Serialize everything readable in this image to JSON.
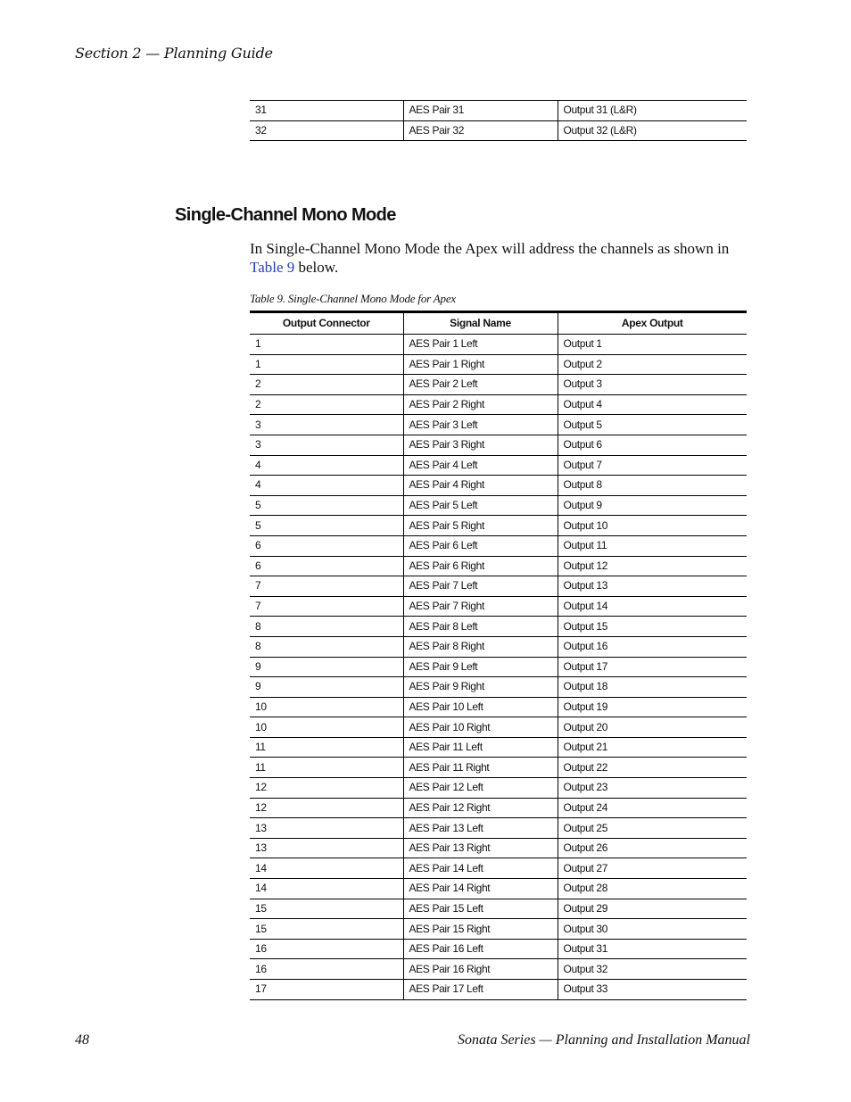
{
  "header": {
    "running_head": "Section 2 — Planning Guide"
  },
  "previous_table_rows": [
    {
      "connector": "31",
      "signal": "AES Pair 31",
      "output": "Output 31 (L&R)"
    },
    {
      "connector": "32",
      "signal": "AES Pair 32",
      "output": "Output 32 (L&R)"
    }
  ],
  "section": {
    "heading": "Single-Channel Mono Mode",
    "paragraph_before_link": "In Single-Channel Mono Mode the Apex will address the channels as shown in ",
    "link_text": "Table 9",
    "paragraph_after_link": " below.",
    "link_color": "#1f3fd6"
  },
  "table": {
    "caption": "Table 9.  Single-Channel Mono Mode for Apex",
    "columns": [
      "Output Connector",
      "Signal Name",
      "Apex Output"
    ],
    "rows": [
      {
        "connector": "1",
        "signal": "AES Pair 1 Left",
        "output": "Output 1"
      },
      {
        "connector": "1",
        "signal": "AES Pair 1 Right",
        "output": "Output 2"
      },
      {
        "connector": "2",
        "signal": "AES Pair 2 Left",
        "output": "Output 3"
      },
      {
        "connector": "2",
        "signal": "AES Pair 2 Right",
        "output": "Output 4"
      },
      {
        "connector": "3",
        "signal": "AES Pair 3 Left",
        "output": "Output 5"
      },
      {
        "connector": "3",
        "signal": "AES Pair 3 Right",
        "output": "Output 6"
      },
      {
        "connector": "4",
        "signal": "AES Pair 4 Left",
        "output": "Output 7"
      },
      {
        "connector": "4",
        "signal": "AES Pair 4 Right",
        "output": "Output 8"
      },
      {
        "connector": "5",
        "signal": "AES Pair 5 Left",
        "output": "Output 9"
      },
      {
        "connector": "5",
        "signal": "AES Pair 5 Right",
        "output": "Output 10"
      },
      {
        "connector": "6",
        "signal": "AES Pair 6 Left",
        "output": "Output 11"
      },
      {
        "connector": "6",
        "signal": "AES Pair 6 Right",
        "output": "Output 12"
      },
      {
        "connector": "7",
        "signal": "AES Pair 7 Left",
        "output": "Output 13"
      },
      {
        "connector": "7",
        "signal": "AES Pair 7 Right",
        "output": "Output 14"
      },
      {
        "connector": "8",
        "signal": "AES Pair 8 Left",
        "output": "Output 15"
      },
      {
        "connector": "8",
        "signal": "AES Pair 8 Right",
        "output": "Output 16"
      },
      {
        "connector": "9",
        "signal": "AES Pair 9 Left",
        "output": "Output 17"
      },
      {
        "connector": "9",
        "signal": "AES Pair 9 Right",
        "output": "Output 18"
      },
      {
        "connector": "10",
        "signal": "AES Pair 10 Left",
        "output": "Output 19"
      },
      {
        "connector": "10",
        "signal": "AES Pair 10 Right",
        "output": "Output 20"
      },
      {
        "connector": "11",
        "signal": "AES Pair 11 Left",
        "output": "Output 21"
      },
      {
        "connector": "11",
        "signal": "AES Pair 11 Right",
        "output": "Output 22"
      },
      {
        "connector": "12",
        "signal": "AES Pair 12 Left",
        "output": "Output 23"
      },
      {
        "connector": "12",
        "signal": "AES Pair 12 Right",
        "output": "Output 24"
      },
      {
        "connector": "13",
        "signal": "AES Pair 13 Left",
        "output": "Output 25"
      },
      {
        "connector": "13",
        "signal": "AES Pair 13 Right",
        "output": "Output 26"
      },
      {
        "connector": "14",
        "signal": "AES Pair 14 Left",
        "output": "Output 27"
      },
      {
        "connector": "14",
        "signal": "AES Pair 14 Right",
        "output": "Output 28"
      },
      {
        "connector": "15",
        "signal": "AES Pair 15 Left",
        "output": "Output 29"
      },
      {
        "connector": "15",
        "signal": "AES Pair 15 Right",
        "output": "Output 30"
      },
      {
        "connector": "16",
        "signal": "AES Pair 16 Left",
        "output": "Output 31"
      },
      {
        "connector": "16",
        "signal": "AES Pair 16 Right",
        "output": "Output 32"
      },
      {
        "connector": "17",
        "signal": "AES Pair 17 Left",
        "output": "Output 33"
      }
    ]
  },
  "footer": {
    "page_number": "48",
    "manual_title": "Sonata Series  —  Planning and Installation Manual"
  }
}
